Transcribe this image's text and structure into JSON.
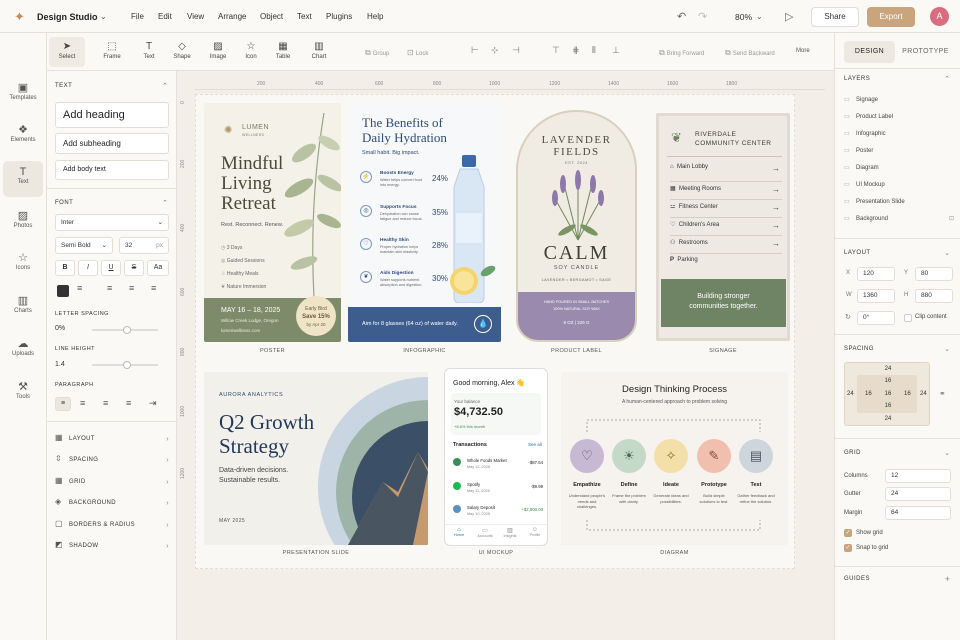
{
  "app": {
    "name": "Design Studio"
  },
  "menu": [
    "File",
    "Edit",
    "View",
    "Arrange",
    "Object",
    "Text",
    "Plugins",
    "Help"
  ],
  "header": {
    "zoom": "80%",
    "share": "Share",
    "export": "Export",
    "avatar": "A"
  },
  "rail": [
    {
      "label": "Templates",
      "icon": "templates-icon"
    },
    {
      "label": "Elements",
      "icon": "elements-icon"
    },
    {
      "label": "Text",
      "icon": "text-icon"
    },
    {
      "label": "Photos",
      "icon": "photos-icon"
    },
    {
      "label": "Icons",
      "icon": "icons-icon"
    },
    {
      "label": "Charts",
      "icon": "charts-icon"
    },
    {
      "label": "Uploads",
      "icon": "uploads-icon"
    },
    {
      "label": "Tools",
      "icon": "tools-icon"
    }
  ],
  "help": "?",
  "toolbar": {
    "tools": [
      "Select",
      "Frame",
      "Text",
      "Shape",
      "Image",
      "Icon",
      "Table",
      "Chart"
    ],
    "group": "Group",
    "lock": "Lock",
    "bring_forward": "Bring Forward",
    "send_backward": "Send Backward",
    "more": "More"
  },
  "left": {
    "text_title": "TEXT",
    "add_heading": "Add heading",
    "add_subheading": "Add subheading",
    "add_body": "Add body text",
    "font_title": "FONT",
    "font_family": "Inter",
    "font_weight": "Semi Bold",
    "font_size": "32",
    "font_unit": "px",
    "case_btn": "Aa",
    "letter_spacing_title": "LETTER SPACING",
    "letter_spacing": "0%",
    "line_height_title": "LINE HEIGHT",
    "line_height": "1.4",
    "paragraph_title": "PARAGRAPH",
    "accordions": [
      "LAYOUT",
      "SPACING",
      "GRID",
      "BACKGROUND",
      "BORDERS & RADIUS",
      "SHADOW"
    ]
  },
  "ruler": {
    "h": [
      "200",
      "400",
      "600",
      "800",
      "1000",
      "1200",
      "1400",
      "1600",
      "1800"
    ],
    "v": [
      "0",
      "200",
      "400",
      "600",
      "800",
      "1000",
      "1200"
    ]
  },
  "captions": [
    "POSTER",
    "INFOGRAPHIC",
    "PRODUCT LABEL",
    "SIGNAGE",
    "PRESENTATION SLIDE",
    "UI MOCKUP",
    "DIAGRAM"
  ],
  "poster": {
    "brand": "LUMEN",
    "brand_sub": "WELLNESS",
    "title1": "Mindful",
    "title2": "Living",
    "title3": "Retreat",
    "tagline": "Rest. Reconnect. Renew.",
    "items": [
      "3 Days",
      "Guided Sessions",
      "Healthy Meals",
      "Nature Immersion"
    ],
    "dates": "MAY 16 – 18, 2025",
    "venue": "Willow Creek Lodge, Oregon",
    "site": "lumenwellness.com",
    "badge1": "Early Bird",
    "badge2": "Save 15%",
    "badge3": "by Apr 20"
  },
  "infographic": {
    "title1": "The Benefits of",
    "title2": "Daily Hydration",
    "subtitle": "Small habit. Big impact.",
    "items": [
      {
        "title": "Boosts Energy",
        "desc": "Water helps convert food into energy.",
        "pct": "24%"
      },
      {
        "title": "Supports Focus",
        "desc": "Dehydration can cause fatigue and reduce focus.",
        "pct": "35%"
      },
      {
        "title": "Healthy Skin",
        "desc": "Proper hydration helps maintain skin elasticity.",
        "pct": "28%"
      },
      {
        "title": "Aids Digestion",
        "desc": "Water supports nutrient absorption and digestion.",
        "pct": "30%"
      }
    ],
    "footer": "Aim for 8 glasses (64 oz) of water daily."
  },
  "label": {
    "top1": "LAVENDER",
    "top2": "FIELDS",
    "est": "EST. 2024",
    "brand": "CALM",
    "product": "SOY CANDLE",
    "notes": "LAVENDER • BERGAMOT • SAGE",
    "made1": "HAND POURED IN SMALL BATCHES",
    "made2": "100% NATURAL SOY WAX",
    "weight": "8 OZ | 226 G"
  },
  "signage": {
    "title1": "RIVERDALE",
    "title2": "COMMUNITY CENTER",
    "rows": [
      "Main Lobby",
      "Meeting Rooms",
      "Fitness Center",
      "Children's Area",
      "Restrooms",
      "Parking"
    ],
    "footer1": "Building stronger",
    "footer2": "communities together."
  },
  "slide": {
    "brand": "AURORA ANALYTICS",
    "title1": "Q2 Growth",
    "title2": "Strategy",
    "sub1": "Data-driven decisions.",
    "sub2": "Sustainable results.",
    "date": "MAY 2025"
  },
  "mockup": {
    "greeting": "Good morning, Alex 👋",
    "balance_label": "Your balance",
    "balance": "$4,732.50",
    "delta": "+8.6% this month",
    "tx_title": "Transactions",
    "see_all": "See all",
    "tx": [
      {
        "name": "Whole Foods Market",
        "date": "May 12, 2025",
        "amt": "-$87.64"
      },
      {
        "name": "Spotify",
        "date": "May 11, 2025",
        "amt": "-$9.99"
      },
      {
        "name": "Salary Deposit",
        "date": "May 10, 2025",
        "amt": "+$2,900.00"
      }
    ],
    "nav": [
      "Home",
      "Accounts",
      "Insights",
      "Profile"
    ]
  },
  "diagram": {
    "title": "Design Thinking Process",
    "subtitle": "A human-centered approach to problem solving",
    "steps": [
      {
        "name": "Empathize",
        "desc": "Understand people's needs and challenges.",
        "color": "#c7b8d4"
      },
      {
        "name": "Define",
        "desc": "Frame the problem with clarity.",
        "color": "#c4d9c8"
      },
      {
        "name": "Ideate",
        "desc": "Generate ideas and possibilities.",
        "color": "#f3dfa8"
      },
      {
        "name": "Prototype",
        "desc": "Build simple solutions to test.",
        "color": "#f0bfae"
      },
      {
        "name": "Test",
        "desc": "Gather feedback and refine the solution.",
        "color": "#cfd5dc"
      }
    ]
  },
  "right": {
    "tab_design": "DESIGN",
    "tab_prototype": "PROTOTYPE",
    "layers_title": "LAYERS",
    "layers": [
      "Signage",
      "Product Label",
      "Infographic",
      "Poster",
      "Diagram",
      "UI Mockup",
      "Presentation Slide",
      "Background"
    ],
    "layout_title": "LAYOUT",
    "x_label": "X",
    "x": "120",
    "y_label": "Y",
    "y": "80",
    "w_label": "W",
    "w": "1360",
    "h_label": "H",
    "h": "880",
    "rotation": "0°",
    "clip": "Clip content",
    "spacing_title": "SPACING",
    "spacing": {
      "top": "24",
      "inner_top": "16",
      "left": "24",
      "inner_left": "16",
      "center": "16",
      "inner_right": "16",
      "right": "24",
      "inner_bottom": "16",
      "bottom": "24"
    },
    "grid_title": "GRID",
    "columns_label": "Columns",
    "columns": "12",
    "gutter_label": "Gutter",
    "gutter": "24",
    "margin_label": "Margin",
    "margin": "64",
    "show_grid": "Show grid",
    "snap_grid": "Snap to grid",
    "guides_title": "GUIDES"
  },
  "colors": {
    "accent": "#c9a47c",
    "poster_green": "#7d8b6a",
    "info_blue": "#2f4a7a",
    "label_purple": "#9a8aad",
    "sign_green": "#6f8464",
    "avatar": "#d96d7f"
  }
}
